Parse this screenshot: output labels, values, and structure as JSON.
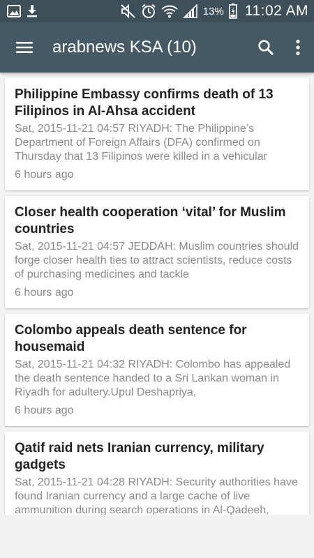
{
  "status_bar": {
    "battery_percent": "13%",
    "time": "11:02 AM",
    "icons": [
      "gallery-icon",
      "download-icon",
      "mute-icon",
      "alarm-icon",
      "wifi-icon",
      "signal-icon",
      "battery-icon"
    ]
  },
  "app_bar": {
    "title": "arabnews KSA (10)",
    "icons": [
      "menu-icon",
      "search-icon",
      "more-vert-icon"
    ]
  },
  "articles": [
    {
      "title": "Philippine Embassy confirms death of 13 Filipinos in Al-Ahsa accident",
      "snippet": "Sat, 2015-11-21 04:57 RIYADH: The Philippine’s Department of Foreign Affairs (DFA) confirmed on Thursday that 13 Filipinos were killed in a vehicular",
      "time_ago": "6 hours ago"
    },
    {
      "title": "Closer health cooperation ‘vital’ for Muslim countries",
      "snippet": "Sat, 2015-11-21 04:57 JEDDAH: Muslim countries should forge closer health ties to attract scientists, reduce costs of purchasing medicines and tackle",
      "time_ago": "6 hours ago"
    },
    {
      "title": "Colombo appeals death sentence for housemaid",
      "snippet": "Sat, 2015-11-21 04:32 RIYADH: Colombo has appealed the death sentence handed to a Sri Lankan woman in Riyadh for adultery.Upul Deshapriya,",
      "time_ago": "6 hours ago"
    },
    {
      "title": "Qatif raid nets Iranian currency, military gadgets",
      "snippet": "Sat, 2015-11-21 04:28 RIYADH: Security authorities have found Iranian currency and a large cache of live ammunition during search operations in Al-Qadeeh,",
      "time_ago": ""
    }
  ],
  "colors": {
    "status_bar": "#3d5059",
    "app_bar": "#455a64",
    "background": "#f2f2f2",
    "card": "#ffffff",
    "title_text": "#222222",
    "meta_text": "#8a8a8a"
  }
}
